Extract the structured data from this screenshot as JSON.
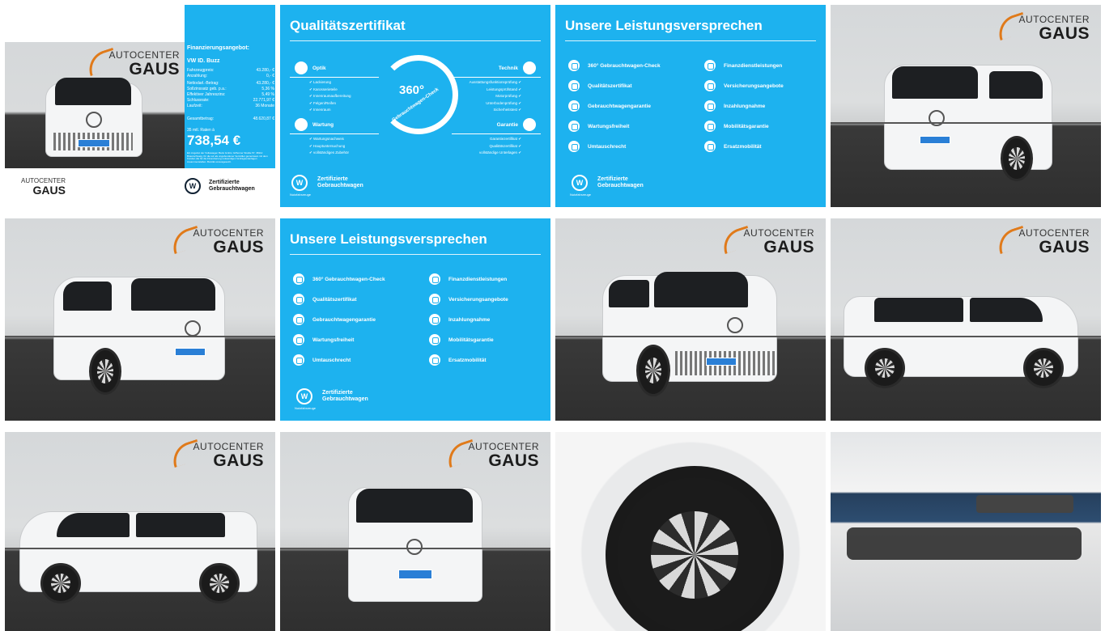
{
  "dealer": {
    "line1": "AUTOCENTER",
    "line2": "GAUS"
  },
  "finance": {
    "heading": "Finanzierungsangebot:",
    "model": "VW ID. Buzz",
    "rows": [
      {
        "label": "Fahrzeugpreis:",
        "value": "43.280,- €"
      },
      {
        "label": "Anzahlung:",
        "value": "0,- €"
      },
      {
        "label": "Nettodarl.-Betrag:",
        "value": "43.280,- €"
      },
      {
        "label": "Sollzinssatz geb. p.a.:",
        "value": "5,36 %"
      },
      {
        "label": "Effektiver Jahreszins:",
        "value": "5,49 %"
      },
      {
        "label": "Schlussrate:",
        "value": "22.771,97 €"
      },
      {
        "label": "Laufzeit:",
        "value": "36 Monate"
      },
      {
        "label": "Gesamtbetrag:",
        "value": "48.620,87 €"
      }
    ],
    "rate_label": "35 mtl. Raten à",
    "rate": "738,54 €",
    "fine_print": "Ein Angebot der Volkswagen Bank GmbH, Gifhorner Straße 57, 38112 Braunschweig, für die wir als ungebundener Vermittler gemeinsam mit dem Kunden die für die Finanzierung notwendigen Vertragsunterlagen zusammenstellen. Bonität vorausgesetzt."
  },
  "vw_badge": {
    "label_line1": "Zertifizierte",
    "label_line2": "Gebrauchtwagen",
    "sub": "Nutzfahrzeuge"
  },
  "quality": {
    "title": "Qualitätszertifikat",
    "ring_number": "360°",
    "ring_caption": "Gebrauchtwagen-Check",
    "sections": [
      {
        "name": "Optik",
        "items": [
          "Lackierung",
          "Karosserieteile",
          "Innenraumaufbereitung",
          "Felgen/Reifen",
          "Innenraum"
        ]
      },
      {
        "name": "Wartung",
        "items": [
          "Wartungsnachweis",
          "Hauptuntersuchung",
          "vollständiges Zubehör"
        ]
      },
      {
        "name": "Technik",
        "items": [
          "Ausstattungsfunktionsprüfung",
          "Leistungsprüfstand",
          "Motorprüfung",
          "Unterbodenprüfung",
          "Sicherheitstest"
        ]
      },
      {
        "name": "Garantie",
        "items": [
          "Garantiezertifikat",
          "Qualitätszertifikat",
          "vollständige Unterlagen"
        ]
      }
    ]
  },
  "promise": {
    "title": "Unsere Leistungsversprechen",
    "left": [
      "360° Gebrauchtwagen-Check",
      "Qualitätszertifikat",
      "Gebrauchtwagengarantie",
      "Wartungsfreiheit",
      "Umtauschrecht"
    ],
    "right": [
      "Finanzdienstleistungen",
      "Versicherungsangebote",
      "Inzahlungnahme",
      "Mobilitätsgarantie",
      "Ersatzmobilität"
    ]
  },
  "plate_text": "ID. Buzz",
  "colors": {
    "brand_blue": "#1db2ef",
    "floor": "#333333",
    "accent_orange": "#e07a1a"
  }
}
